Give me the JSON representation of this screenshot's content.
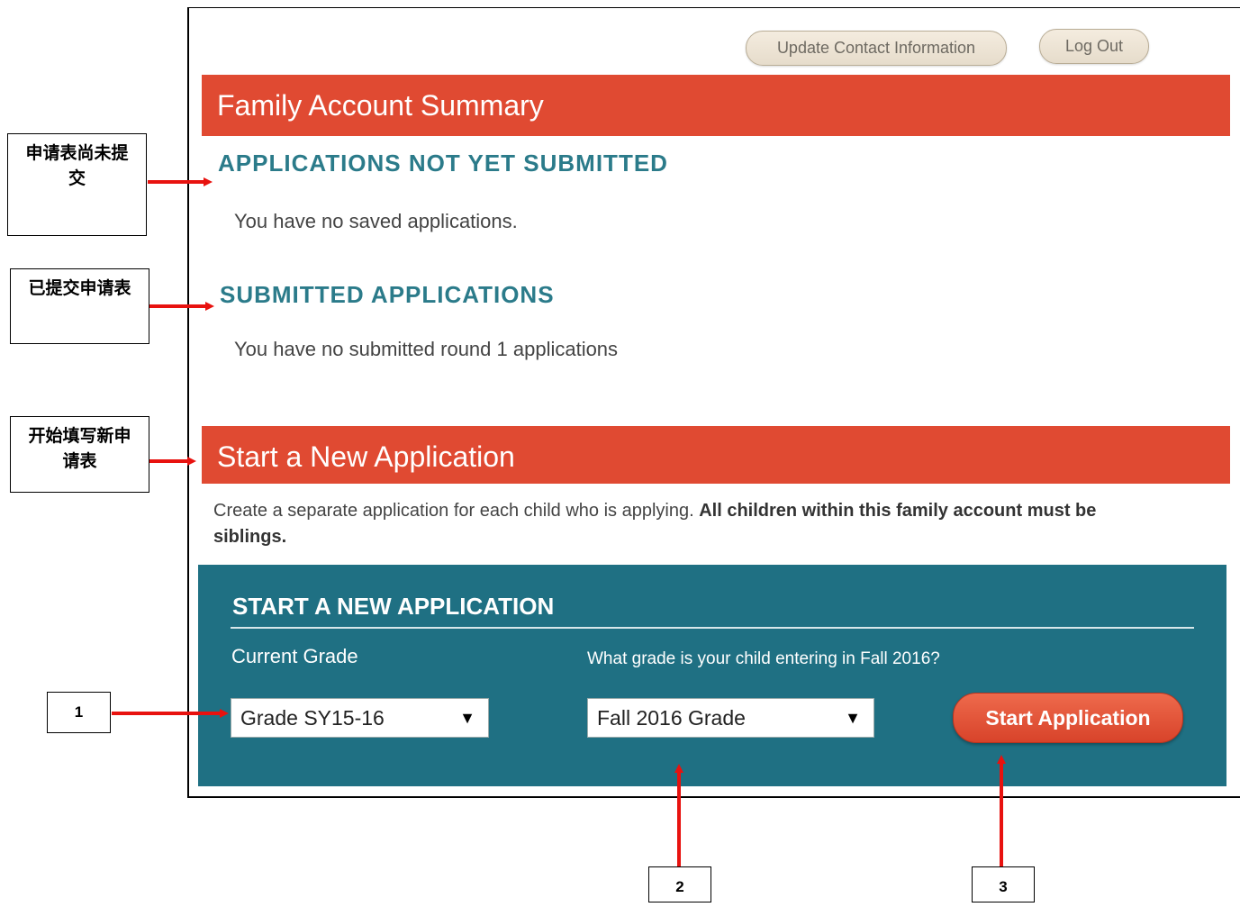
{
  "header": {
    "update_contact_label": "Update Contact Information",
    "logout_label": "Log Out"
  },
  "summary": {
    "title": "Family Account Summary",
    "not_submitted_title": "APPLICATIONS NOT YET SUBMITTED",
    "not_submitted_text": "You have no saved applications.",
    "submitted_title": "SUBMITTED APPLICATIONS",
    "submitted_text": "You have no submitted round 1 applications"
  },
  "new_application": {
    "banner_title": "Start a New Application",
    "description_normal": "Create a separate application for each child who is applying. ",
    "description_bold": "All children within this family account must be siblings.",
    "panel_title": "START A NEW APPLICATION",
    "current_grade_label": "Current Grade",
    "entering_grade_label": "What grade is your child entering in Fall 2016?",
    "current_grade_value": "Grade SY15-16",
    "fall_grade_value": "Fall 2016 Grade",
    "start_button_label": "Start Application",
    "dropdown_arrow": "▼"
  },
  "annotations": {
    "not_submitted_label": "申请表尚未提交",
    "submitted_label": "已提交申请表",
    "new_application_label": "开始填写新申请表",
    "step1": "1",
    "step2": "2",
    "step3": "3",
    "arrow_color": "#e8120f"
  }
}
